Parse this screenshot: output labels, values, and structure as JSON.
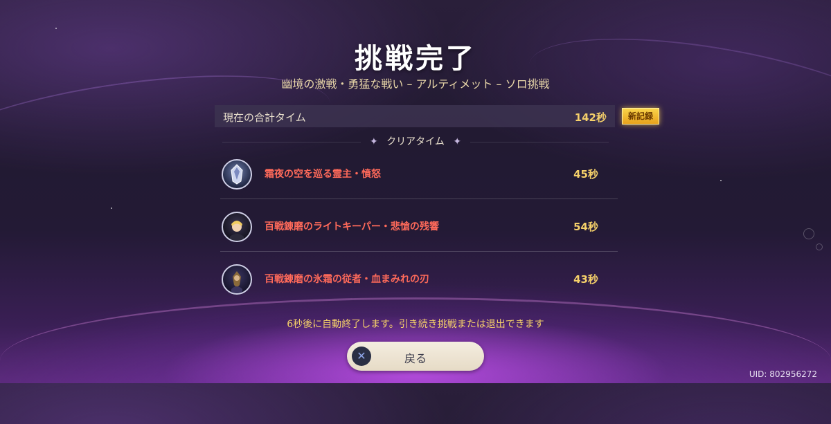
{
  "header": {
    "title": "挑戦完了",
    "subtitle": "幽境の激戦・勇猛な戦い – アルティメット – ソロ挑戦"
  },
  "total": {
    "label": "現在の合計タイム",
    "value": "142秒",
    "badge": "新記録"
  },
  "clear_section": {
    "heading": "クリアタイム",
    "rows": [
      {
        "name": "霜夜の空を巡る霊主・憤怒",
        "time": "45秒",
        "icon": "boss-mask-icon"
      },
      {
        "name": "百戦錬磨のライトキーパー・悲愴の残響",
        "time": "54秒",
        "icon": "lightkeeper-portrait-icon"
      },
      {
        "name": "百戦錬磨の氷霜の従者・血まみれの刃",
        "time": "43秒",
        "icon": "frost-attendant-portrait-icon"
      }
    ]
  },
  "notice": "6秒後に自動終了します。引き続き挑戦または退出できます",
  "back_button": {
    "label": "戻る",
    "icon": "circle-x-button-icon"
  },
  "uid": "UID: 802956272",
  "colors": {
    "accent_gold": "#f5d06a",
    "enemy_red": "#ff6a5a",
    "badge": "#f9d34a"
  }
}
